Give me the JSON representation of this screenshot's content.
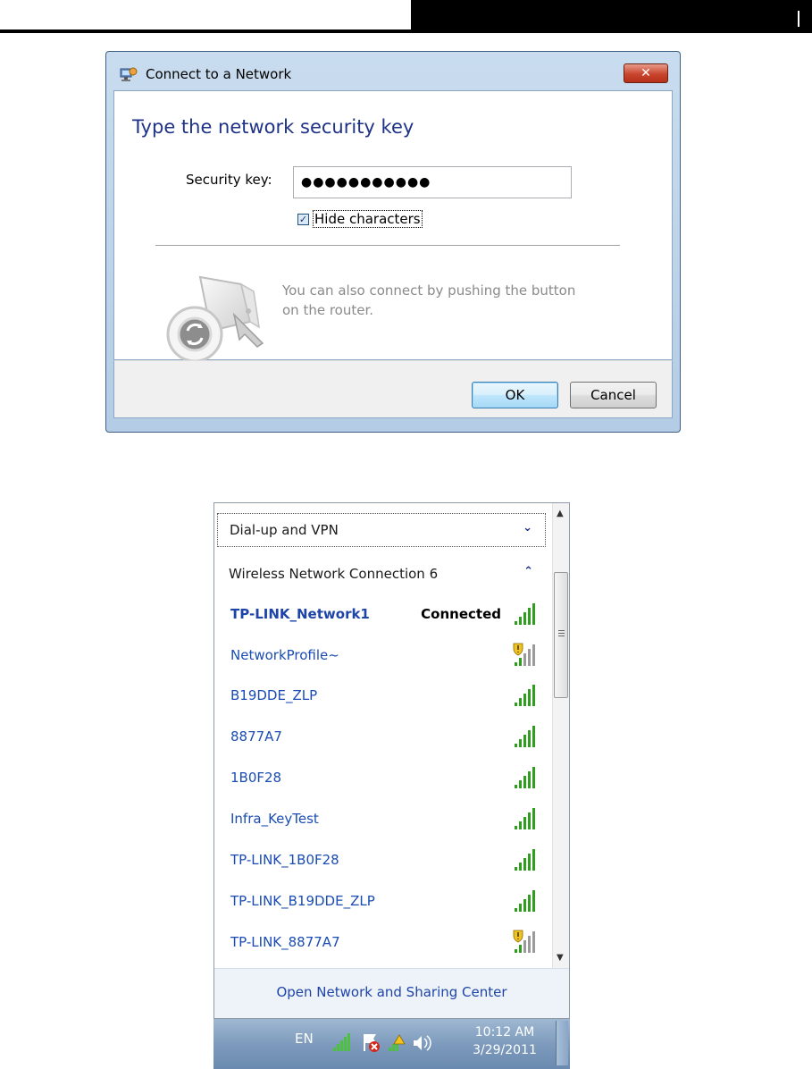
{
  "dialog": {
    "title": "Connect to a Network",
    "close_label": "✕",
    "heading": "Type the network security key",
    "security_key_label": "Security key:",
    "security_key_value": "●●●●●●●●●●●",
    "hide_characters_label": "Hide characters",
    "hide_characters_checked": true,
    "wps_text": "You can also connect by pushing the button on the router.",
    "ok_label": "OK",
    "cancel_label": "Cancel"
  },
  "flyout": {
    "sections": [
      {
        "title": "Dial-up and VPN",
        "chevron": "⌄"
      },
      {
        "title": "Wireless Network Connection 6",
        "chevron": "⌃"
      }
    ],
    "networks": [
      {
        "name": "TP-LINK_Network1",
        "status": "Connected",
        "secured_warning": false
      },
      {
        "name": "NetworkProfile~",
        "status": "",
        "secured_warning": true
      },
      {
        "name": "B19DDE_ZLP",
        "status": "",
        "secured_warning": false
      },
      {
        "name": "8877A7",
        "status": "",
        "secured_warning": false
      },
      {
        "name": "1B0F28",
        "status": "",
        "secured_warning": false
      },
      {
        "name": "Infra_KeyTest",
        "status": "",
        "secured_warning": false
      },
      {
        "name": "TP-LINK_1B0F28",
        "status": "",
        "secured_warning": false
      },
      {
        "name": "TP-LINK_B19DDE_ZLP",
        "status": "",
        "secured_warning": false
      },
      {
        "name": "TP-LINK_8877A7",
        "status": "",
        "secured_warning": true
      }
    ],
    "open_center_label": "Open Network and Sharing Center"
  },
  "taskbar": {
    "language": "EN",
    "time": "10:12 AM",
    "date": "3/29/2011"
  },
  "colors": {
    "link_blue": "#1e44a8",
    "heading_blue": "#1e3287",
    "signal_green": "#2f9d1e"
  }
}
